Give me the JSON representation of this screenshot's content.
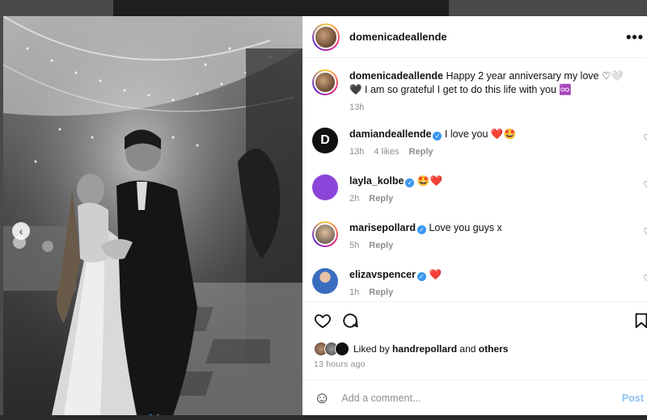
{
  "post": {
    "author": "domenicadeallende",
    "more_label": "•••",
    "caption": {
      "username": "domenicadeallende",
      "text": "Happy 2 year anniversary my love ♡🤍🖤 I am so grateful I get to do this life with you ♾️",
      "time": "13h"
    }
  },
  "photo": {
    "description_icon": "carousel-previous-icon",
    "prev_glyph": "‹"
  },
  "comments": [
    {
      "username": "damiandeallende",
      "verified": true,
      "text": "I love you ❤️🤩",
      "time": "13h",
      "likes": "4 likes",
      "reply": "Reply"
    },
    {
      "username": "layla_kolbe",
      "verified": true,
      "text": "🤩❤️",
      "time": "2h",
      "likes": "",
      "reply": "Reply"
    },
    {
      "username": "marisepollard",
      "verified": true,
      "text": "Love you guys x",
      "time": "5h",
      "likes": "",
      "reply": "Reply"
    },
    {
      "username": "elizavspencer",
      "verified": true,
      "text": "❤️",
      "time": "1h",
      "likes": "",
      "reply": "Reply"
    }
  ],
  "engagement": {
    "liked_prefix": "Liked by",
    "liked_user": "handrepollard",
    "liked_and": "and",
    "liked_others": "others",
    "time_ago": "13 hours ago"
  },
  "composer": {
    "placeholder": "Add a comment...",
    "post_label": "Post"
  },
  "colors": {
    "accent": "#3897f0",
    "heart_red": "#ed4956"
  }
}
